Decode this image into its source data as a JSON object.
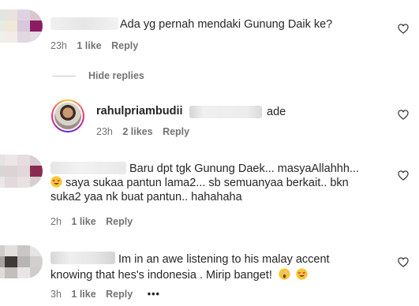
{
  "comments": [
    {
      "text": "Ada yg pernah mendaki Gunung Daik ke?",
      "time": "23h",
      "likes": "1 like",
      "reply": "Reply"
    },
    {
      "text_line1": "Baru dpt tgk Gunung Daek... masyaAllahhh...",
      "text_line2": "saya sukaa pantun lama2... sb semuanyaa berkait.. bkn",
      "text_line3": "suka2 yaa nk buat pantun.. hahahaha",
      "time": "2h",
      "likes": "1 like",
      "reply": "Reply"
    },
    {
      "text_line1": "Im in an awe listening to his malay accent",
      "text_line2": "knowing that hes's indonesia . Mirip banget!",
      "time": "3h",
      "likes": "1 like",
      "reply": "Reply",
      "more": "•••"
    }
  ],
  "hide_replies": "Hide replies",
  "reply_comment": {
    "username": "rahulpriambudii",
    "text": "ade",
    "time": "23h",
    "likes": "2 likes",
    "reply": "Reply"
  },
  "icons": {
    "like": "heart-outline-icon",
    "emoji_smile": "smiling-face-with-heart-eyes-icon",
    "emoji_shocked": "face-screaming-icon"
  },
  "colors": {
    "text": "#262626",
    "meta": "#737373",
    "avatar_ring": "#d62976"
  }
}
